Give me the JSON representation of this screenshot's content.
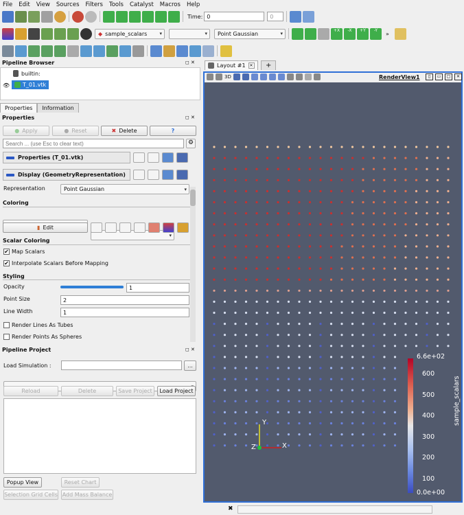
{
  "menu": [
    "File",
    "Edit",
    "View",
    "Sources",
    "Filters",
    "Tools",
    "Catalyst",
    "Macros",
    "Help"
  ],
  "toolbar": {
    "time_label": "Time:",
    "time_value": "0",
    "time_index": "0",
    "array_select": "sample_scalars",
    "component_select": "",
    "representation_select": "Point Gaussian",
    "axis_buttons": [
      "+X",
      "-X",
      "+Y",
      "-Y"
    ]
  },
  "pipeline_browser": {
    "title": "Pipeline Browser",
    "items": [
      {
        "label": "builtin:"
      },
      {
        "label": "T_01.vtk"
      }
    ]
  },
  "properties_panel": {
    "tabs": [
      "Properties",
      "Information"
    ],
    "title": "Properties",
    "apply": "Apply",
    "reset": "Reset",
    "delete": "Delete",
    "help": "?",
    "search_placeholder": "Search ... (use Esc to clear text)",
    "sections": {
      "properties": "Properties (T_01.vtk)",
      "display": "Display (GeometryRepresentation)"
    },
    "representation_label": "Representation",
    "representation_value": "Point Gaussian",
    "coloring_header": "Coloring",
    "coloring_value": "sample_scalars",
    "edit_label": "Edit",
    "scalar_coloring_header": "Scalar Coloring",
    "map_scalars": "Map Scalars",
    "interpolate": "Interpolate Scalars Before Mapping",
    "styling_header": "Styling",
    "opacity_label": "Opacity",
    "opacity_value": "1",
    "point_size_label": "Point Size",
    "point_size_value": "2",
    "line_width_label": "Line Width",
    "line_width_value": "1",
    "render_lines": "Render Lines As Tubes",
    "render_points": "Render Points As Spheres",
    "opacity_fraction": 1.0
  },
  "pipeline_project": {
    "title": "Pipeline Project",
    "load_sim_label": "Load Simulation :",
    "browse": "...",
    "reload": "Reload",
    "delete": "Delete",
    "save": "Save Project",
    "load": "Load Project",
    "popup": "Popup View",
    "reset_chart": "Reset Chart",
    "selection": "Selection Grid Cells",
    "add_mass": "Add Mass Balance"
  },
  "layout": {
    "tab": "Layout #1",
    "add_tab": "+",
    "view_name": "RenderView1",
    "mode_3d": "3D"
  },
  "colorbar": {
    "title": "sample_scalars",
    "max_label": "6.6e+02",
    "min_label": "0.0e+00",
    "ticks": [
      "600",
      "500",
      "400",
      "300",
      "200",
      "100"
    ],
    "range": [
      0,
      660
    ]
  },
  "axes": {
    "y": "Y",
    "z": "Z",
    "x": "X"
  },
  "colors": {
    "render_bg": "#525a6d",
    "selection_blue": "#2f6fd6",
    "high": "#b40426",
    "low": "#3b4cc0"
  }
}
